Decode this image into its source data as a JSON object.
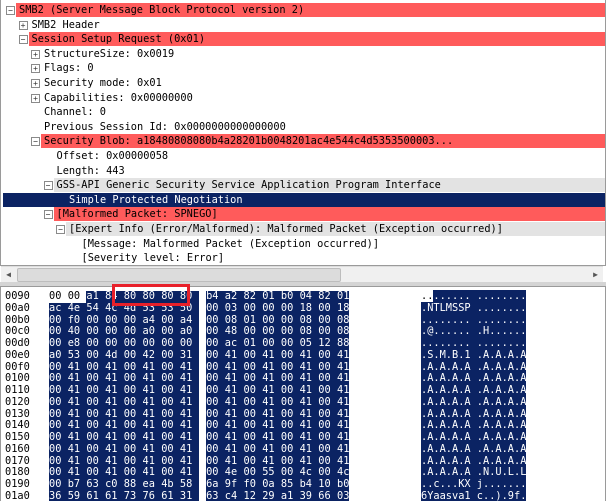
{
  "colors": {
    "error_row": "#ff5b5b",
    "selected": "#0b2363",
    "group_row": "#e3e3e3",
    "annotation_box": "#e8202a"
  },
  "tree": [
    {
      "label": "SMB2 (Server Message Block Protocol version 2)",
      "level": 0,
      "expander": "minus",
      "style": "red"
    },
    {
      "label": "SMB2 Header",
      "level": 1,
      "expander": "plus",
      "style": ""
    },
    {
      "label": "Session Setup Request (0x01)",
      "level": 1,
      "expander": "minus",
      "style": "red"
    },
    {
      "label": "StructureSize: 0x0019",
      "level": 2,
      "expander": "plus",
      "style": ""
    },
    {
      "label": "Flags: 0",
      "level": 2,
      "expander": "plus",
      "style": ""
    },
    {
      "label": "Security mode: 0x01",
      "level": 2,
      "expander": "plus",
      "style": ""
    },
    {
      "label": "Capabilities: 0x00000000",
      "level": 2,
      "expander": "plus",
      "style": ""
    },
    {
      "label": "Channel: 0",
      "level": 2,
      "expander": "",
      "style": ""
    },
    {
      "label": "Previous Session Id: 0x0000000000000000",
      "level": 2,
      "expander": "",
      "style": ""
    },
    {
      "label": "Security Blob: a18480808080b4a28201b0048201ac4e544c4d5353500003...",
      "level": 2,
      "expander": "minus",
      "style": "red"
    },
    {
      "label": "Offset: 0x00000058",
      "level": 3,
      "expander": "",
      "style": ""
    },
    {
      "label": "Length: 443",
      "level": 3,
      "expander": "",
      "style": ""
    },
    {
      "label": "GSS-API Generic Security Service Application Program Interface",
      "level": 3,
      "expander": "minus",
      "style": "gray"
    },
    {
      "label": "Simple Protected Negotiation",
      "level": 4,
      "expander": "",
      "style": "sel"
    },
    {
      "label": "[Malformed Packet: SPNEGO]",
      "level": 3,
      "expander": "minus",
      "style": "red"
    },
    {
      "label": "[Expert Info (Error/Malformed): Malformed Packet (Exception occurred)]",
      "level": 4,
      "expander": "minus",
      "style": "gray"
    },
    {
      "label": "[Message: Malformed Packet (Exception occurred)]",
      "level": 5,
      "expander": "",
      "style": ""
    },
    {
      "label": "[Severity level: Error]",
      "level": 5,
      "expander": "",
      "style": ""
    }
  ],
  "hex": [
    {
      "offset": "0090",
      "bytes": [
        "00",
        "00",
        "a1",
        "84",
        "80",
        "80",
        "80",
        "80",
        "b4",
        "a2",
        "82",
        "01",
        "b0",
        "04",
        "82",
        "01"
      ],
      "ascii": "........ ........"
    },
    {
      "offset": "00a0",
      "bytes": [
        "ac",
        "4e",
        "54",
        "4c",
        "4d",
        "53",
        "53",
        "50",
        "00",
        "03",
        "00",
        "00",
        "00",
        "18",
        "00",
        "18"
      ],
      "ascii": ".NTLMSSP ........"
    },
    {
      "offset": "00b0",
      "bytes": [
        "00",
        "f0",
        "00",
        "00",
        "00",
        "a4",
        "00",
        "a4",
        "00",
        "08",
        "01",
        "00",
        "00",
        "08",
        "00",
        "08"
      ],
      "ascii": "........ ........"
    },
    {
      "offset": "00c0",
      "bytes": [
        "00",
        "40",
        "00",
        "00",
        "00",
        "a0",
        "00",
        "a0",
        "00",
        "48",
        "00",
        "00",
        "00",
        "08",
        "00",
        "08"
      ],
      "ascii": ".@...... .H......"
    },
    {
      "offset": "00d0",
      "bytes": [
        "00",
        "e8",
        "00",
        "00",
        "00",
        "00",
        "00",
        "00",
        "00",
        "ac",
        "01",
        "00",
        "00",
        "05",
        "12",
        "88"
      ],
      "ascii": "........ ........"
    },
    {
      "offset": "00e0",
      "bytes": [
        "a0",
        "53",
        "00",
        "4d",
        "00",
        "42",
        "00",
        "31",
        "00",
        "41",
        "00",
        "41",
        "00",
        "41",
        "00",
        "41"
      ],
      "ascii": ".S.M.B.1 .A.A.A.A"
    },
    {
      "offset": "00f0",
      "bytes": [
        "00",
        "41",
        "00",
        "41",
        "00",
        "41",
        "00",
        "41",
        "00",
        "41",
        "00",
        "41",
        "00",
        "41",
        "00",
        "41"
      ],
      "ascii": ".A.A.A.A .A.A.A.A"
    },
    {
      "offset": "0100",
      "bytes": [
        "00",
        "41",
        "00",
        "41",
        "00",
        "41",
        "00",
        "41",
        "00",
        "41",
        "00",
        "41",
        "00",
        "41",
        "00",
        "41"
      ],
      "ascii": ".A.A.A.A .A.A.A.A"
    },
    {
      "offset": "0110",
      "bytes": [
        "00",
        "41",
        "00",
        "41",
        "00",
        "41",
        "00",
        "41",
        "00",
        "41",
        "00",
        "41",
        "00",
        "41",
        "00",
        "41"
      ],
      "ascii": ".A.A.A.A .A.A.A.A"
    },
    {
      "offset": "0120",
      "bytes": [
        "00",
        "41",
        "00",
        "41",
        "00",
        "41",
        "00",
        "41",
        "00",
        "41",
        "00",
        "41",
        "00",
        "41",
        "00",
        "41"
      ],
      "ascii": ".A.A.A.A .A.A.A.A"
    },
    {
      "offset": "0130",
      "bytes": [
        "00",
        "41",
        "00",
        "41",
        "00",
        "41",
        "00",
        "41",
        "00",
        "41",
        "00",
        "41",
        "00",
        "41",
        "00",
        "41"
      ],
      "ascii": ".A.A.A.A .A.A.A.A"
    },
    {
      "offset": "0140",
      "bytes": [
        "00",
        "41",
        "00",
        "41",
        "00",
        "41",
        "00",
        "41",
        "00",
        "41",
        "00",
        "41",
        "00",
        "41",
        "00",
        "41"
      ],
      "ascii": ".A.A.A.A .A.A.A.A"
    },
    {
      "offset": "0150",
      "bytes": [
        "00",
        "41",
        "00",
        "41",
        "00",
        "41",
        "00",
        "41",
        "00",
        "41",
        "00",
        "41",
        "00",
        "41",
        "00",
        "41"
      ],
      "ascii": ".A.A.A.A .A.A.A.A"
    },
    {
      "offset": "0160",
      "bytes": [
        "00",
        "41",
        "00",
        "41",
        "00",
        "41",
        "00",
        "41",
        "00",
        "41",
        "00",
        "41",
        "00",
        "41",
        "00",
        "41"
      ],
      "ascii": ".A.A.A.A .A.A.A.A"
    },
    {
      "offset": "0170",
      "bytes": [
        "00",
        "41",
        "00",
        "41",
        "00",
        "41",
        "00",
        "41",
        "00",
        "41",
        "00",
        "41",
        "00",
        "41",
        "00",
        "41"
      ],
      "ascii": ".A.A.A.A .A.A.A.A"
    },
    {
      "offset": "0180",
      "bytes": [
        "00",
        "41",
        "00",
        "41",
        "00",
        "41",
        "00",
        "41",
        "00",
        "4e",
        "00",
        "55",
        "00",
        "4c",
        "00",
        "4c"
      ],
      "ascii": ".A.A.A.A .N.U.L.L"
    },
    {
      "offset": "0190",
      "bytes": [
        "00",
        "b7",
        "63",
        "c0",
        "88",
        "ea",
        "4b",
        "58",
        "6a",
        "9f",
        "f0",
        "0a",
        "85",
        "b4",
        "10",
        "b0"
      ],
      "ascii": "..c...KX j......."
    },
    {
      "offset": "01a0",
      "bytes": [
        "36",
        "59",
        "61",
        "61",
        "73",
        "76",
        "61",
        "31",
        "63",
        "c4",
        "12",
        "29",
        "a1",
        "39",
        "66",
        "03"
      ],
      "ascii": "6Yaasva1 c..).9f."
    }
  ],
  "selection_start_byte": 2
}
